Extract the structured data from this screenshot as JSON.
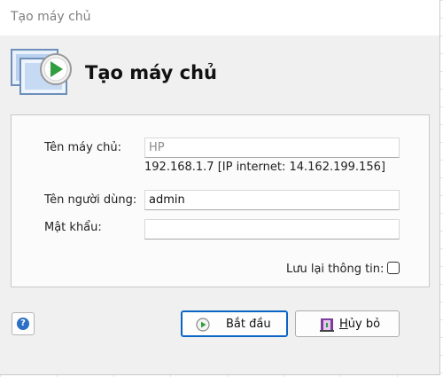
{
  "window": {
    "title": "Tạo máy chủ"
  },
  "header": {
    "heading": "Tạo máy chủ",
    "icon": "server-play-icon"
  },
  "form": {
    "server_name_label": "Tên máy chủ:",
    "server_name_value": "HP",
    "ip_info": "192.168.1.7 [IP internet: 14.162.199.156]",
    "username_label": "Tên người dùng:",
    "username_value": "admin",
    "password_label": "Mật khẩu:",
    "password_value": "",
    "save_info_label": "Lưu lại thông tin:",
    "save_info_checked": false
  },
  "buttons": {
    "help_icon": "question-icon",
    "start_label": "Bắt đầu",
    "cancel_label": "Hủy bỏ",
    "cancel_mnemonic": "H",
    "cancel_rest": "ủy bỏ"
  },
  "colors": {
    "accent": "#0a64c4",
    "play_green": "#2e9e3f"
  }
}
